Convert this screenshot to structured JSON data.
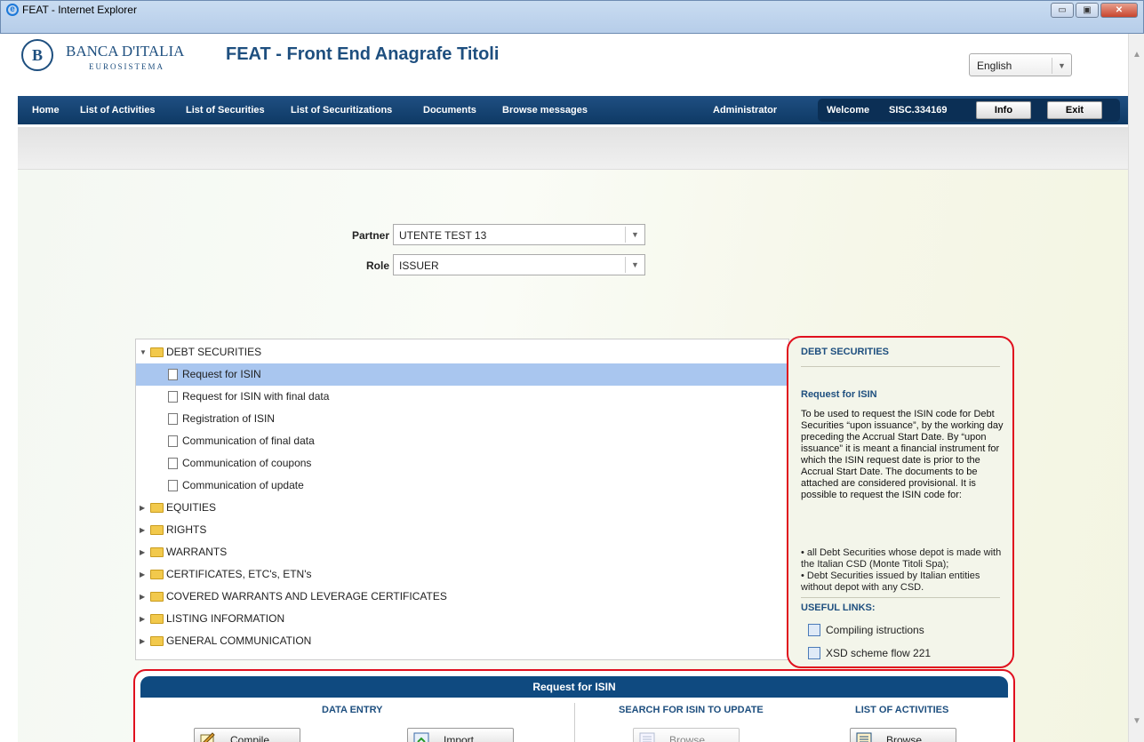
{
  "window": {
    "title": "FEAT - Internet Explorer",
    "min": "▭",
    "max": "▣",
    "close": "✕"
  },
  "header": {
    "logo_name": "BANCA D'ITALIA",
    "logo_sub": "EUROSISTEMA",
    "logo_mark": "B",
    "app_title": "FEAT - Front End Anagrafe Titoli",
    "language": "English"
  },
  "nav": {
    "items": [
      "Home",
      "List of Activities",
      "List of Securities",
      "List of Securitizations",
      "Documents",
      "Browse messages"
    ],
    "administrator": "Administrator",
    "welcome": "Welcome",
    "user": "SISC.334169",
    "info": "Info",
    "exit": "Exit"
  },
  "filters": {
    "partner_label": "Partner",
    "partner_value": "UTENTE TEST 13",
    "role_label": "Role",
    "role_value": "ISSUER"
  },
  "tree": {
    "debt": "DEBT SECURITIES",
    "debt_children": [
      "Request for ISIN",
      "Request for ISIN with final data",
      "Registration of ISIN",
      "Communication of final data",
      "Communication of coupons",
      "Communication of update"
    ],
    "selected_index": 0,
    "categories": [
      "EQUITIES",
      "RIGHTS",
      "WARRANTS",
      "CERTIFICATES, ETC's, ETN's",
      "COVERED WARRANTS AND LEVERAGE CERTIFICATES",
      "LISTING INFORMATION",
      "GENERAL COMMUNICATION"
    ]
  },
  "info": {
    "heading": "DEBT SECURITIES",
    "subheading": "Request for ISIN",
    "description": "To be used to request the ISIN code for Debt Securities “upon issuance”, by the working day preceding the Accrual Start Date. By “upon issuance” it is meant a financial instrument for which the ISIN request date is prior to the Accrual Start Date. The documents to be attached are considered provisional. It is possible to request the ISIN code for:",
    "bullet1": "• all Debt Securities whose depot is made with the Italian CSD (Monte Titoli Spa);",
    "bullet2": "• Debt Securities issued by Italian entities without depot with any CSD.",
    "links_heading": "USEFUL LINKS:",
    "link1": "Compiling istructions",
    "link2": "XSD scheme flow 221"
  },
  "action": {
    "title": "Request for ISIN",
    "data_entry": "DATA ENTRY",
    "search": "SEARCH FOR ISIN TO UPDATE",
    "list": "LIST OF ACTIVITIES",
    "compile": "Compile",
    "import": "Import",
    "browse_search": "Browse",
    "browse_list": "Browse"
  },
  "colors": {
    "brand": "#1e4f7f",
    "highlight": "#e0101e",
    "selection": "#a9c6ef"
  }
}
